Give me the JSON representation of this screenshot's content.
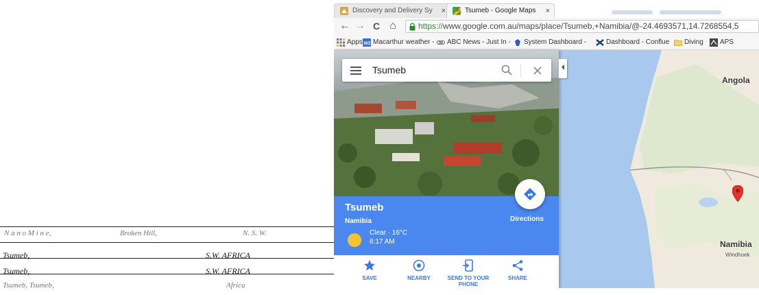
{
  "ledger": {
    "rows": [
      {
        "place": "N a n o   M i n e,",
        "location": "Broken Hill,",
        "region": "N. S. W."
      },
      {
        "place": "Tsumeb,",
        "region": "S.W. AFRICA"
      },
      {
        "place": "Tsumeb,",
        "region": "S.W. AFRICA"
      },
      {
        "place": "Tsumeb,   Tsumeb,",
        "region": "Africa"
      }
    ]
  },
  "browser": {
    "tabs": [
      {
        "title": "Discovery and Delivery Sy",
        "close": "×",
        "active": false,
        "icon": "museum-icon"
      },
      {
        "title": "Tsumeb - Google Maps",
        "close": "×",
        "active": true,
        "icon": "google-maps-icon"
      }
    ],
    "nav": {
      "back": "←",
      "forward": "→",
      "reload": "C",
      "home": "⌂"
    },
    "address": {
      "secure": "https://",
      "url": "www.google.com.au/maps/place/Tsumeb,+Namibia/@-24.4693571,14.7268554,5"
    },
    "bookmarks": [
      {
        "label": "Apps",
        "icon": "apps-grid-icon",
        "color": "#e84c3d"
      },
      {
        "label": "Macarthur weather - ",
        "icon": "weather-icon",
        "color": "#3a6fd8"
      },
      {
        "label": "ABC News - Just In - ",
        "icon": "abc-icon",
        "color": "#666666"
      },
      {
        "label": "System Dashboard - ",
        "icon": "dashboard-icon",
        "color": "#2b5fb4"
      },
      {
        "label": "Dashboard - Conflue",
        "icon": "confluence-icon",
        "color": "#1f3f7a"
      },
      {
        "label": "Diving",
        "icon": "folder-icon",
        "color": "#e6b800"
      },
      {
        "label": "APS",
        "icon": "aps-icon",
        "color": "#444444"
      }
    ]
  },
  "maps": {
    "search": {
      "query": "Tsumeb"
    },
    "place": {
      "name": "Tsumeb",
      "country": "Namibia"
    },
    "weather": {
      "condition": "Clear · 16°C",
      "time": "6:17 AM"
    },
    "directions_label": "Directions",
    "actions": [
      {
        "label": "SAVE",
        "icon": "star-icon"
      },
      {
        "label": "NEARBY",
        "icon": "nearby-icon"
      },
      {
        "label": "SEND TO YOUR PHONE",
        "icon": "send-to-phone-icon"
      },
      {
        "label": "SHARE",
        "icon": "share-icon"
      }
    ],
    "map_labels": {
      "angola": "Angola",
      "namibia": "Namibia",
      "windhoek": "Windhoek"
    },
    "colors": {
      "accent": "#4a87ee",
      "action_blue": "#3b78e7",
      "pin": "#e0352b",
      "water": "#a9c8ee",
      "land": "#f1ede2"
    }
  }
}
